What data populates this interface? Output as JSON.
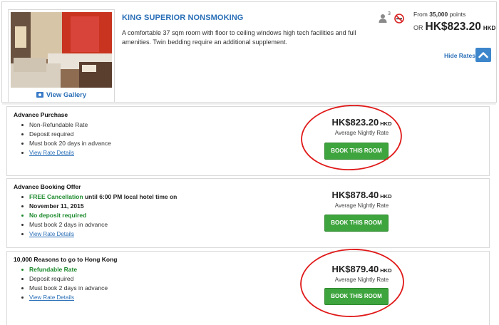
{
  "room": {
    "title": "KING SUPERIOR NONSMOKING",
    "description": "A comfortable 37 sqm room with floor to ceiling windows high tech facilities and full amenities. Twin bedding require an additional supplement.",
    "gallery_label": "View Gallery",
    "occupancy": "3",
    "points_prefix": "From ",
    "points_value": "35,000",
    "points_suffix": " points",
    "or_label": "OR",
    "price": "HK$823.20",
    "currency": "HKD",
    "hide_rates_label": "Hide Rates"
  },
  "rates": [
    {
      "name": "Advance Purchase",
      "bullet1": "Non-Refundable Rate",
      "bullet2": "Deposit required",
      "bullet3": "Must book 20 days in advance",
      "details_link": "View Rate Details",
      "price": "HK$823.20",
      "currency": "HKD",
      "price_note": "Average Nightly Rate",
      "book_label": "BOOK THIS ROOM"
    },
    {
      "name": "Advance Booking Offer",
      "free_cancel": "FREE Cancellation",
      "free_cancel_rest": " until 6:00 PM local hotel time on",
      "free_cancel_date": "November 11, 2015",
      "bullet2": "No deposit required",
      "bullet3": "Must book 2 days in advance",
      "details_link": "View Rate Details",
      "price": "HK$878.40",
      "currency": "HKD",
      "price_note": "Average Nightly Rate",
      "book_label": "BOOK THIS ROOM"
    },
    {
      "name": "10,000 Reasons to go to Hong Kong",
      "bullet1": "Refundable Rate",
      "bullet2": "Deposit required",
      "bullet3": "Must book 2 days in advance",
      "details_link": "View Rate Details",
      "price": "HK$879.40",
      "currency": "HKD",
      "price_note": "Average Nightly Rate",
      "book_label": "BOOK THIS ROOM"
    }
  ],
  "colors": {
    "link_blue": "#2a6fb7",
    "book_green": "#3ea43e",
    "benefit_green": "#1c8a2c",
    "annotation_red": "#e01818",
    "hide_button_blue": "#3d86cc"
  },
  "icons": [
    "gallery-camera-icon",
    "occupancy-person-icon",
    "no-smoking-icon",
    "chevron-up-icon"
  ]
}
